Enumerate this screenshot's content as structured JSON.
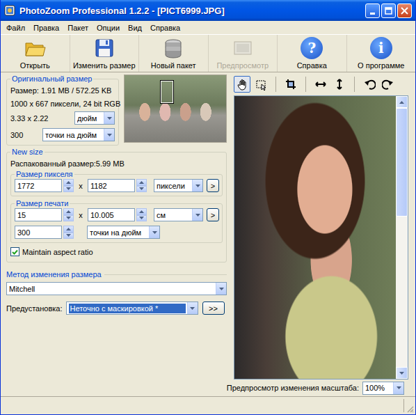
{
  "window": {
    "title": "PhotoZoom Professional 1.2.2 - [PICT6999.JPG]"
  },
  "menu": [
    "Файл",
    "Правка",
    "Пакет",
    "Опции",
    "Вид",
    "Справка"
  ],
  "toolbar": [
    {
      "label": "Открыть",
      "kind": "folder",
      "disabled": false
    },
    {
      "label": "Изменить размер",
      "kind": "floppy",
      "disabled": false
    },
    {
      "label": "Новый пакет",
      "kind": "stack",
      "disabled": false
    },
    {
      "label": "Предпросмотр",
      "kind": "preview",
      "disabled": true
    },
    {
      "label": "Справка",
      "kind": "help",
      "glyph": "?",
      "disabled": false
    },
    {
      "label": "О программе",
      "kind": "about",
      "glyph": "i",
      "disabled": false
    }
  ],
  "original_size": {
    "title": "Оригинальный размер",
    "size_line": "Размер: 1.91 MB / 572.25 KB",
    "pixels_line": "1000 x 667 пиксели, 24 bit RGB",
    "print_size": "3.33 x 2.22",
    "unit": "дюйм",
    "resolution": "300",
    "resolution_unit": "точки на дюйм"
  },
  "new_size": {
    "title": "New size",
    "unpacked": "Распакованный размер:5.99 MB",
    "pixel_size": {
      "title": "Размер пикселя",
      "width": "1772",
      "x": "x",
      "height": "1182",
      "unit": "пиксели",
      "button": ">"
    },
    "print_size": {
      "title": "Размер печати",
      "width": "15",
      "x": "x",
      "height": "10.005",
      "unit": "см",
      "button": ">",
      "resolution": "300",
      "resolution_unit": "точки на дюйм"
    },
    "maintain": {
      "label": "Maintain aspect ratio",
      "checked": true
    }
  },
  "resize_method": {
    "title": "Метод изменения размера",
    "method": "Mitchell",
    "preset_label": "Предустановка:",
    "preset": "Неточно с маскировкой *",
    "preset_button": ">>"
  },
  "view_tools": [
    {
      "kind": "hand",
      "selected": true
    },
    {
      "kind": "marquee",
      "selected": false
    },
    {
      "kind": "crop",
      "selected": false
    },
    {
      "kind": "fitwidth",
      "selected": false
    },
    {
      "kind": "fitheight",
      "selected": false
    },
    {
      "kind": "rotateleft",
      "selected": false
    },
    {
      "kind": "rotateright",
      "selected": false
    }
  ],
  "preview": {
    "scroll": {
      "level": 0.42
    },
    "zoom_label": "Предпросмотр изменения масштаба:",
    "zoom": "100%"
  }
}
